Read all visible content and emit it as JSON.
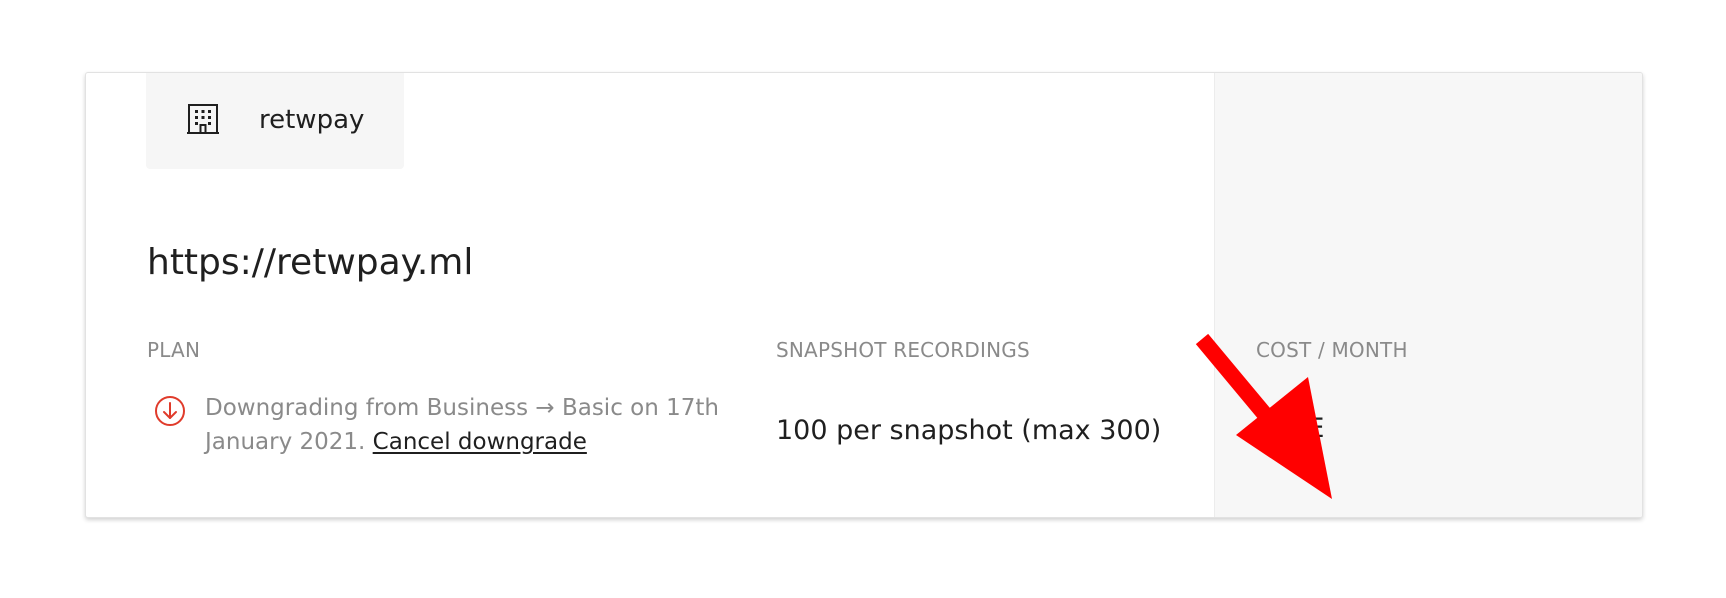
{
  "organization": {
    "name": "retwpay",
    "icon": "building-icon"
  },
  "site": {
    "url": "https://retwpay.ml"
  },
  "plan": {
    "label": "PLAN",
    "status_icon": "downgrade-arrow-icon",
    "status_text": "Downgrading from Business → Basic on 17th January 2021.",
    "cancel_link": "Cancel downgrade"
  },
  "snapshot": {
    "label": "SNAPSHOT RECORDINGS",
    "value": "100 per snapshot (max 300)"
  },
  "cost": {
    "label": "COST / MONTH",
    "value": "FREE"
  },
  "colors": {
    "accent_red": "#e03b2b",
    "annotation_arrow": "#ff0000",
    "muted_text": "#8a8a8a"
  },
  "annotation": {
    "icon": "red-arrow-annotation"
  }
}
